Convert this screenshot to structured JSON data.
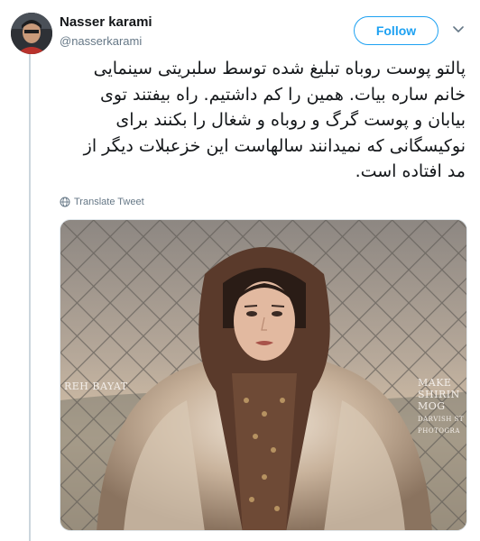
{
  "author": {
    "name": "Nasser karami",
    "handle": "@nasserkarami"
  },
  "actions": {
    "follow_label": "Follow"
  },
  "tweet": {
    "lines": [
      "پالتو پوست روباه تبلیغ شده توسط سلبریتی سینمایی",
      "خانم ساره بیات. همین را کم داشتیم. راه بیفتند توی",
      "بیابان و پوست گرگ و روباه و شغال را بکنند برای",
      "نوکیسگانی که نمیدانند سالهاست این خزعبلات دیگر از",
      "مد افتاده است."
    ]
  },
  "translate": {
    "label": "Translate Tweet"
  },
  "media": {
    "credit_left": "REH BAYAT",
    "credit_right_1": "MAKE",
    "credit_right_2": "SHIRIN MOG",
    "credit_right_3": "DARVISH ST",
    "credit_right_4": "PHOTOGRA"
  },
  "colors": {
    "accent": "#1da1f2",
    "secondary_text": "#657786",
    "thread_line": "#ccd6dd"
  },
  "icons": {
    "caret": "chevron-down-icon",
    "translate": "globe-icon"
  }
}
